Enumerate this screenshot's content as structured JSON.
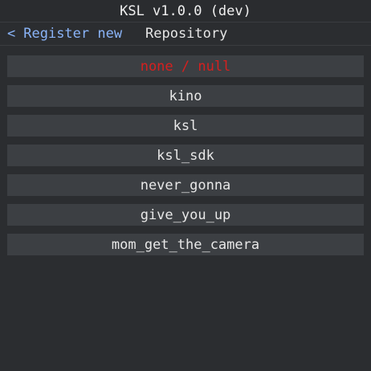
{
  "window": {
    "title": "KSL v1.0.0 (dev)"
  },
  "nav": {
    "back_chevron": "<",
    "back_label": "Register new",
    "title": "Repository"
  },
  "repositories": [
    {
      "label": "none / null",
      "kind": "null"
    },
    {
      "label": "kino"
    },
    {
      "label": "ksl"
    },
    {
      "label": "ksl_sdk"
    },
    {
      "label": "never_gonna"
    },
    {
      "label": "give_you_up"
    },
    {
      "label": "mom_get_the_camera"
    }
  ],
  "colors": {
    "background": "#2b2d30",
    "item_background": "#3c3f43",
    "link": "#8ab4f8",
    "null_item": "#d6201f",
    "text": "#e8e8e8"
  }
}
